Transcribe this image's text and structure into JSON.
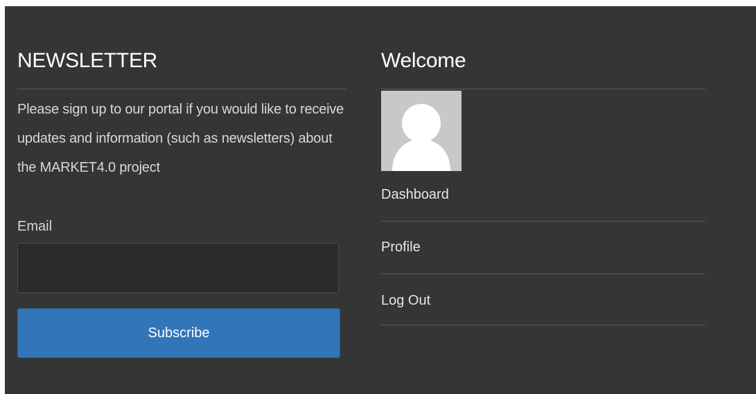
{
  "newsletter": {
    "title": "NEWSLETTER",
    "description": "Please sign up to our portal if you would like to receive updates and information (such as newsletters) about the MARKET4.0 project",
    "email_label": "Email",
    "email_value": "",
    "subscribe_label": "Subscribe"
  },
  "welcome": {
    "title": "Welcome",
    "avatar_icon": "user-silhouette-icon",
    "menu": [
      {
        "label": "Dashboard"
      },
      {
        "label": "Profile"
      },
      {
        "label": "Log Out"
      }
    ]
  },
  "colors": {
    "background": "#353535",
    "accent": "#3276b8",
    "text": "#e6e6e6"
  }
}
